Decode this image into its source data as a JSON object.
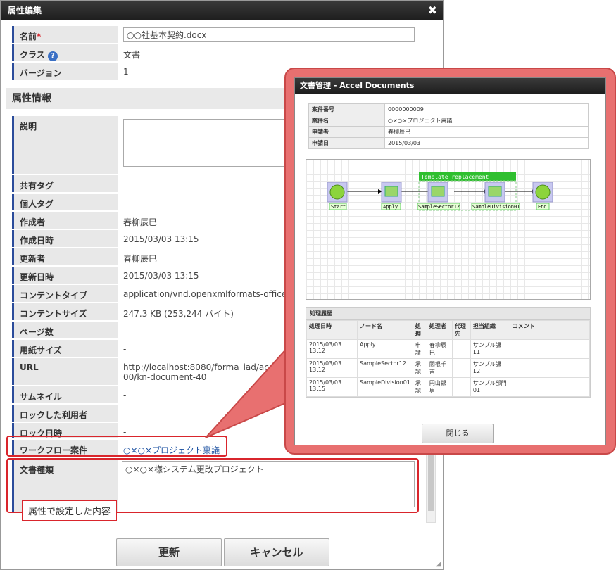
{
  "dialog": {
    "title": "属性編集",
    "close_label": "✖"
  },
  "fields": {
    "name_label": "名前",
    "name_required": "*",
    "name_value": "○○社基本契約.docx",
    "class_label": "クラス",
    "class_help": "?",
    "class_value": "文書",
    "version_label": "バージョン",
    "version_value": "1"
  },
  "section": {
    "title": "属性情報"
  },
  "attrs": [
    {
      "label": "説明",
      "value": ""
    },
    {
      "label": "共有タグ",
      "value": ""
    },
    {
      "label": "個人タグ",
      "value": ""
    },
    {
      "label": "作成者",
      "value": "春柳辰巳"
    },
    {
      "label": "作成日時",
      "value": "2015/03/03 13:15"
    },
    {
      "label": "更新者",
      "value": "春柳辰巳"
    },
    {
      "label": "更新日時",
      "value": "2015/03/03 13:15"
    },
    {
      "label": "コンテントタイプ",
      "value": "application/vnd.openxmlformats-officedocu"
    },
    {
      "label": "コンテントサイズ",
      "value": "247.3 KB (253,244 バイト)"
    },
    {
      "label": "ページ数",
      "value": "-"
    },
    {
      "label": "用紙サイズ",
      "value": "-"
    },
    {
      "label": "URL",
      "value": "http://localhost:8080/forma_iad/acceldocum",
      "value2": "00/kn-document-40"
    },
    {
      "label": "サムネイル",
      "value": "-"
    },
    {
      "label": "ロックした利用者",
      "value": "-"
    },
    {
      "label": "ロック日時",
      "value": "-"
    },
    {
      "label": "ワークフロー案件",
      "value": "○×○×プロジェクト稟議"
    },
    {
      "label": "文書種類",
      "value": "○×○×様システム更改プロジェクト"
    }
  ],
  "caption": "属性で設定した内容",
  "buttons": {
    "update": "更新",
    "cancel": "キャンセル"
  },
  "popup": {
    "title": "文書管理 - Accel Documents",
    "info": [
      {
        "k": "案件番号",
        "v": "0000000009"
      },
      {
        "k": "案件名",
        "v": "○×○×プロジェクト稟議"
      },
      {
        "k": "申請者",
        "v": "春柳辰巳"
      },
      {
        "k": "申請日",
        "v": "2015/03/03"
      }
    ],
    "flow": {
      "group_label": "Template replacement",
      "nodes": [
        "Start",
        "Apply",
        "SampleSector12",
        "SampleDivision01",
        "End"
      ]
    },
    "history": {
      "title": "処理履歴",
      "headers": [
        "処理日時",
        "ノード名",
        "処理",
        "処理者",
        "代理先",
        "担当組織",
        "コメント"
      ],
      "rows": [
        [
          "2015/03/03 13:12",
          "Apply",
          "申請",
          "春柳辰巳",
          "",
          "サンプル課11",
          ""
        ],
        [
          "2015/03/03 13:12",
          "SampleSector12",
          "承認",
          "閣根千吉",
          "",
          "サンプル課12",
          ""
        ],
        [
          "2015/03/03 13:15",
          "SampleDivision01",
          "承認",
          "円山銀男",
          "",
          "サンプル部門01",
          ""
        ]
      ]
    },
    "close_button": "閉じる"
  }
}
